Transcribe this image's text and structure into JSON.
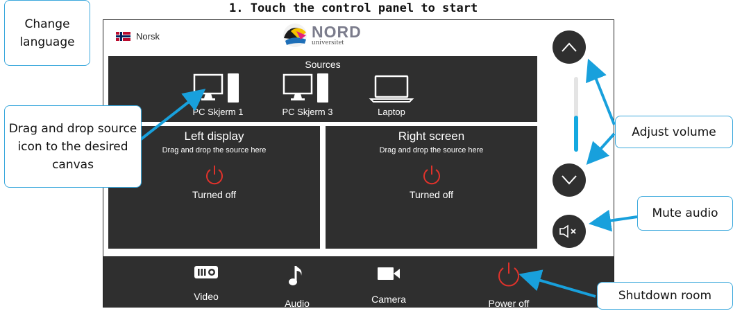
{
  "heading": "1.  Touch the control panel to start",
  "language": {
    "label": "Norsk"
  },
  "logo": {
    "word": "NORD",
    "sub": "universitet"
  },
  "sources": {
    "title": "Sources",
    "items": [
      {
        "label": "PC Skjerm 1",
        "icon": "pc-monitor-icon"
      },
      {
        "label": "PC Skjerm 3",
        "icon": "pc-monitor-icon"
      },
      {
        "label": "Laptop",
        "icon": "laptop-icon"
      }
    ]
  },
  "displays": [
    {
      "title": "Left display",
      "hint": "Drag and drop the source here",
      "status": "Turned off"
    },
    {
      "title": "Right screen",
      "hint": "Drag and drop the source here",
      "status": "Turned off"
    }
  ],
  "volume": {
    "level_fraction": 0.48
  },
  "bottom_bar": [
    {
      "label": "Video",
      "icon": "projector-icon"
    },
    {
      "label": "Audio",
      "icon": "music-note-icon"
    },
    {
      "label": "Camera",
      "icon": "camera-icon"
    },
    {
      "label": "Power off",
      "icon": "power-icon"
    }
  ],
  "callouts": {
    "change_language": "Change language",
    "drag_drop": "Drag and drop source icon to the desired canvas",
    "adjust_volume": "Adjust volume",
    "mute_audio": "Mute audio",
    "shutdown_room": "Shutdown room"
  },
  "colors": {
    "accent": "#14a9e0",
    "panel_dark": "#2f2f2f",
    "power_red": "#e0322b",
    "callout_border": "#3aa8dc"
  }
}
